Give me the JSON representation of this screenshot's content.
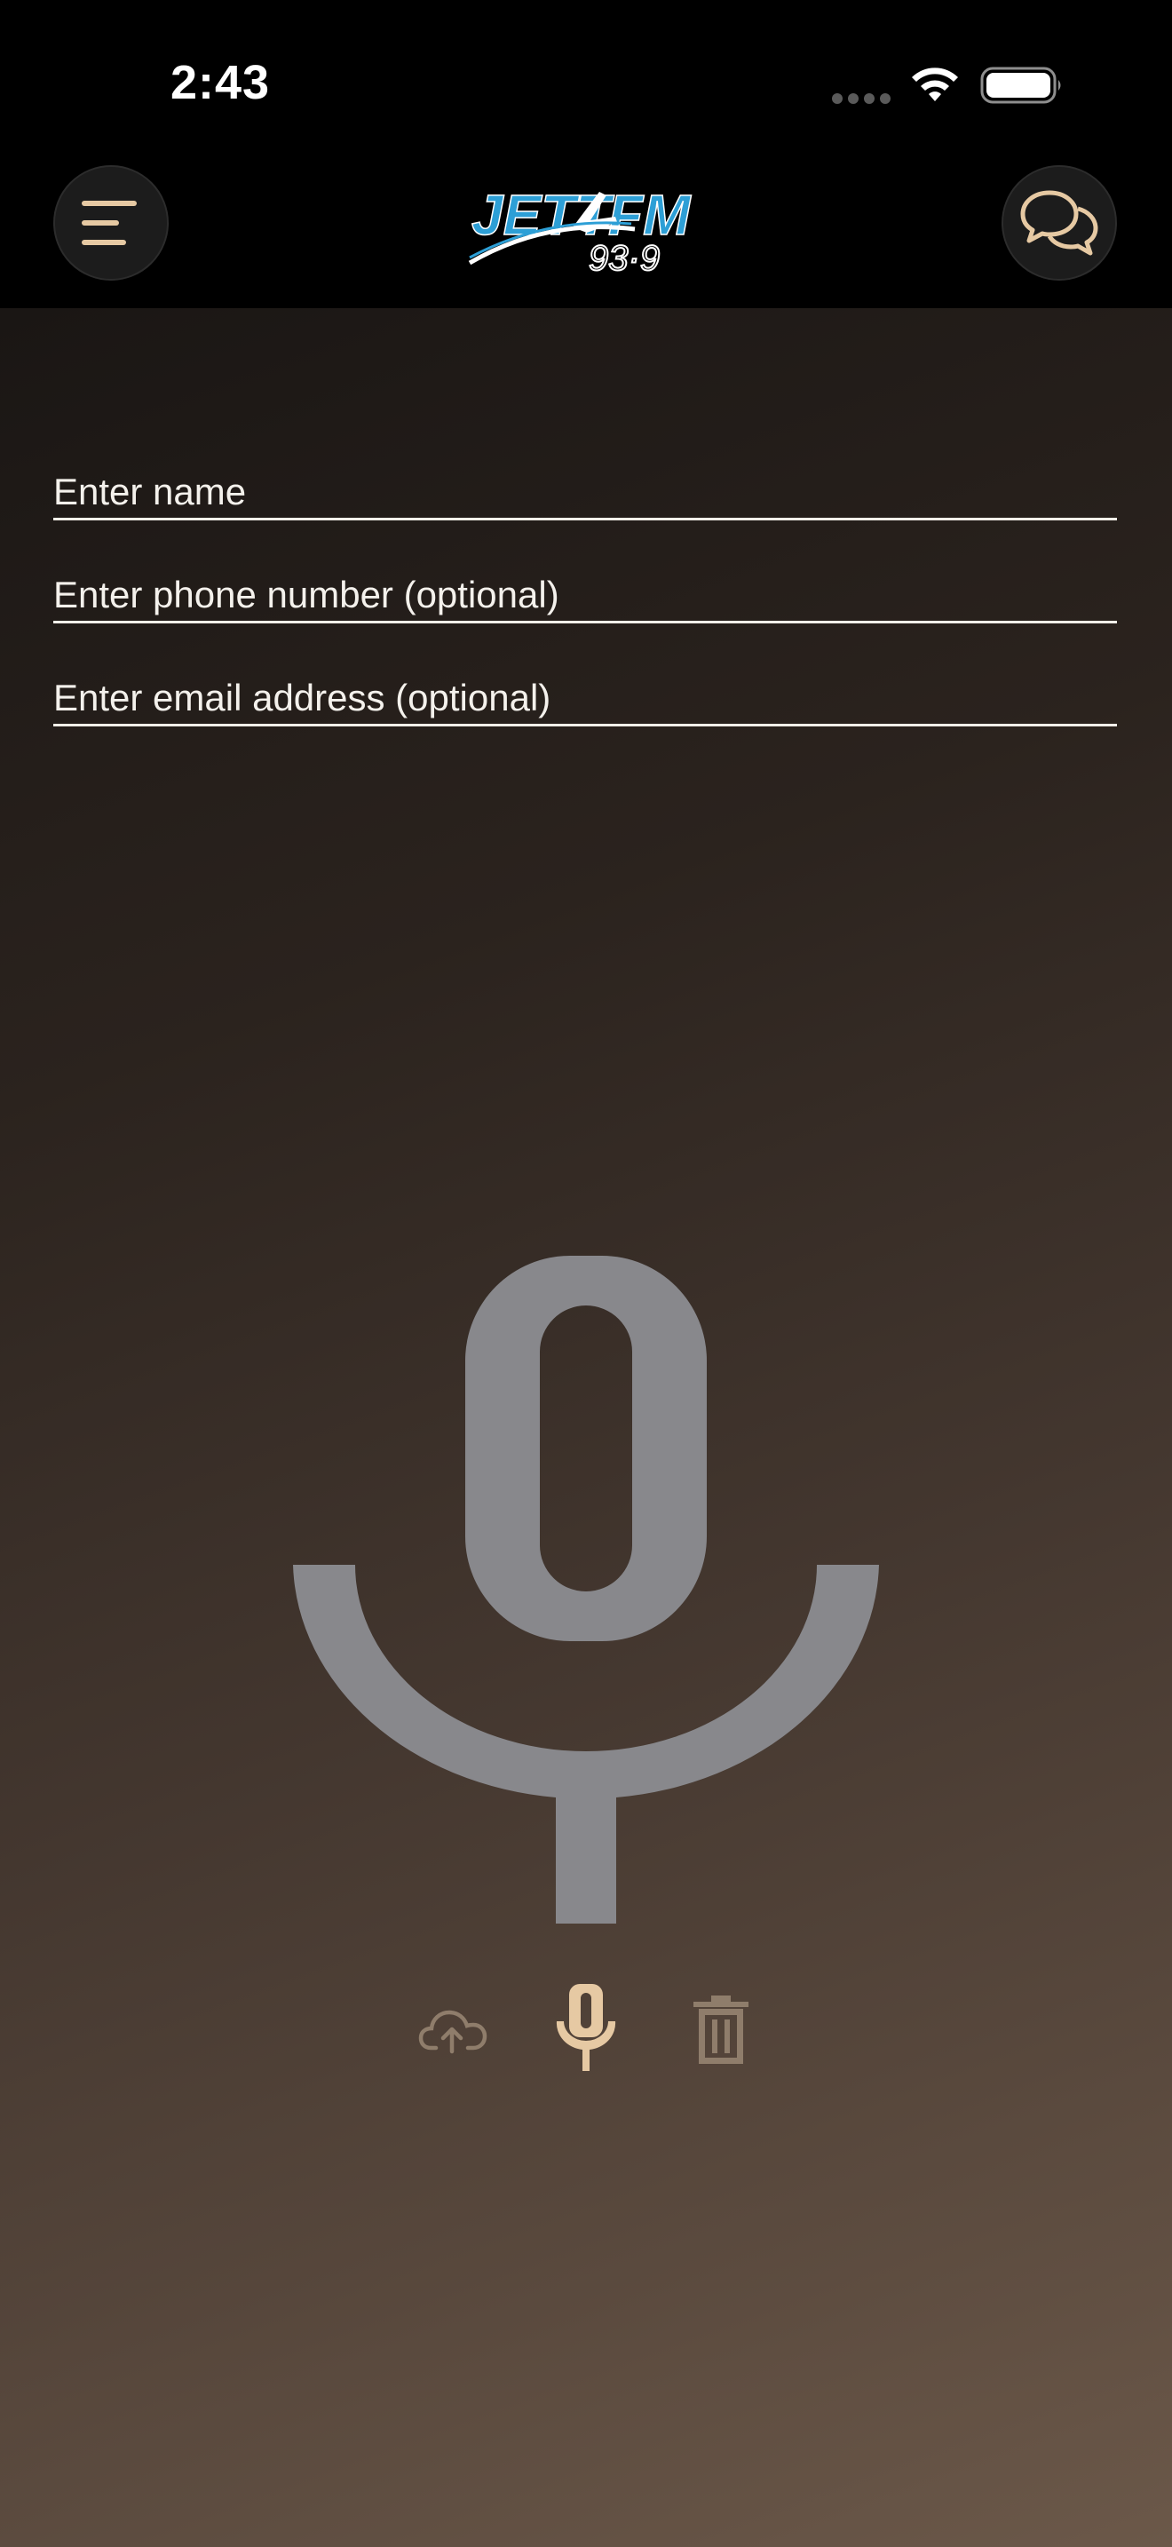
{
  "status_bar": {
    "time": "2:43"
  },
  "header": {
    "menu_icon": "menu-lines-icon",
    "logo_alt": "JETT FM 93.9 logo",
    "chat_icon": "chat-bubbles-icon"
  },
  "form": {
    "name_placeholder": "Enter name",
    "phone_placeholder": "Enter phone number (optional)",
    "email_placeholder": "Enter email address (optional)"
  },
  "recorder": {
    "big_icon": "microphone-icon",
    "upload_icon": "cloud-upload-icon",
    "record_icon": "microphone-icon",
    "delete_icon": "trash-icon"
  },
  "colors": {
    "accent": "#e6c9a3",
    "muted_accent": "#8f7d6b",
    "mic_gray": "#88888c",
    "logo_blue": "#2d9fd6"
  }
}
